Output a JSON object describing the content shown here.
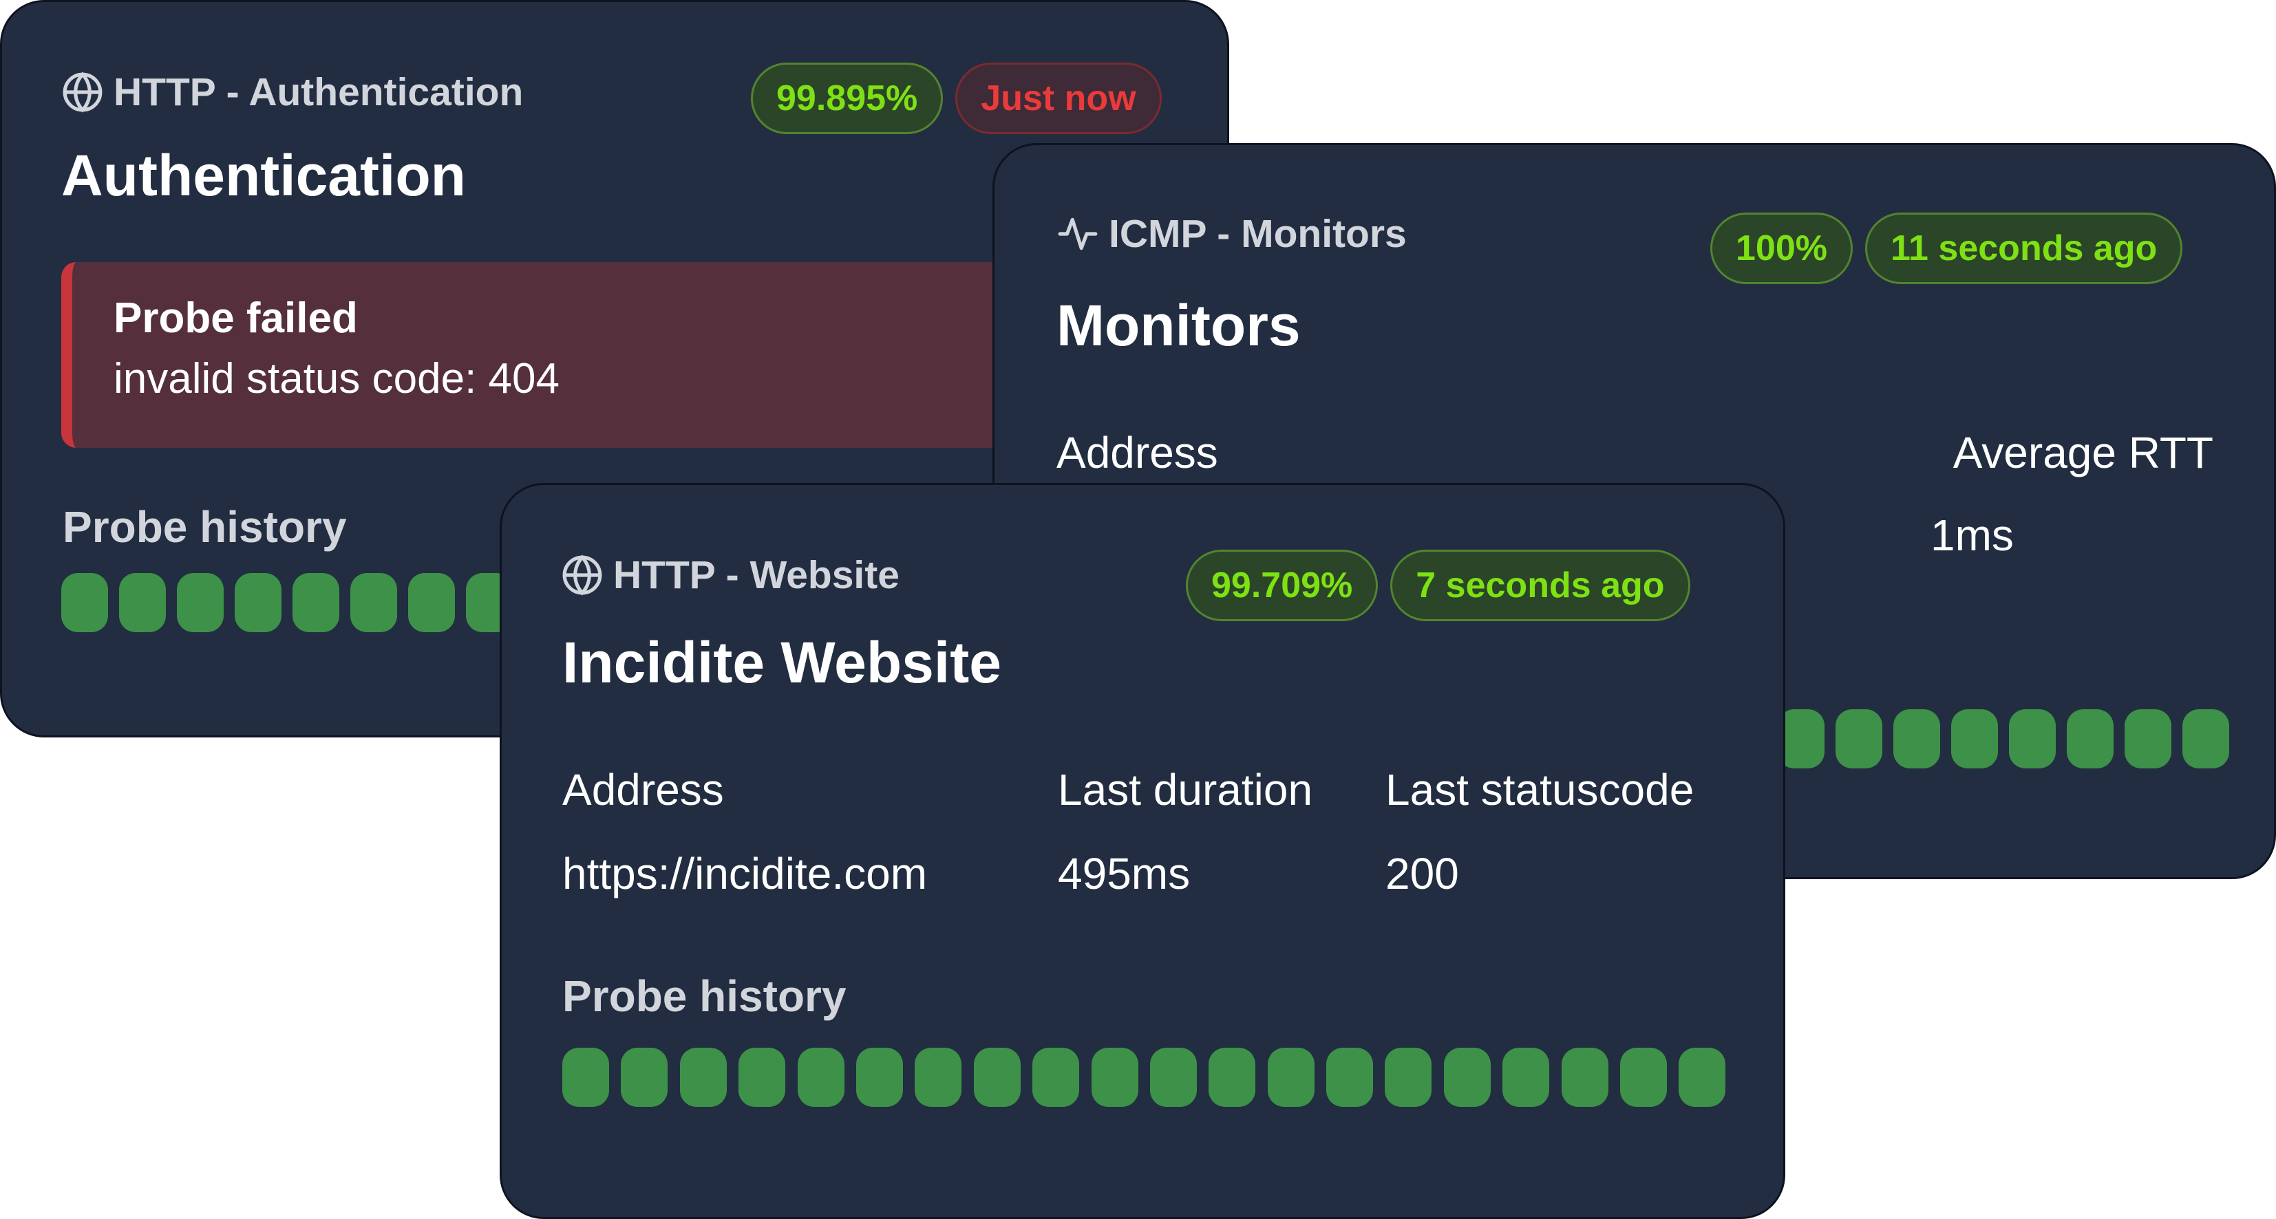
{
  "auth": {
    "type_label": "HTTP - Authentication",
    "icon": "globe-icon",
    "uptime": "99.895%",
    "last_checked": "Just now",
    "title": "Authentication",
    "error_title": "Probe failed",
    "error_message": "invalid status code: 404",
    "history_label": "Probe history",
    "history_count_visible": 8
  },
  "monitors": {
    "type_label": "ICMP - Monitors",
    "icon": "activity-icon",
    "uptime": "100%",
    "last_checked": "11 seconds ago",
    "title": "Monitors",
    "address_label": "Address",
    "rtt_label": "Average RTT",
    "rtt_value": "1ms",
    "history_count_visible": 8
  },
  "website": {
    "type_label": "HTTP - Website",
    "icon": "globe-icon",
    "uptime": "99.709%",
    "last_checked": "7 seconds ago",
    "title": "Incidite Website",
    "address_label": "Address",
    "address_value": "https://incidite.com",
    "duration_label": "Last duration",
    "duration_value": "495ms",
    "status_label": "Last statuscode",
    "status_value": "200",
    "history_label": "Probe history",
    "history_count_visible": 20
  },
  "colors": {
    "card_bg": "#222d41",
    "ok_badge_text": "#7ee114",
    "bad_badge_text": "#ea3b3b",
    "history_ok": "#3e9148",
    "error_bg": "#552f3c",
    "error_border": "#c8363c"
  }
}
